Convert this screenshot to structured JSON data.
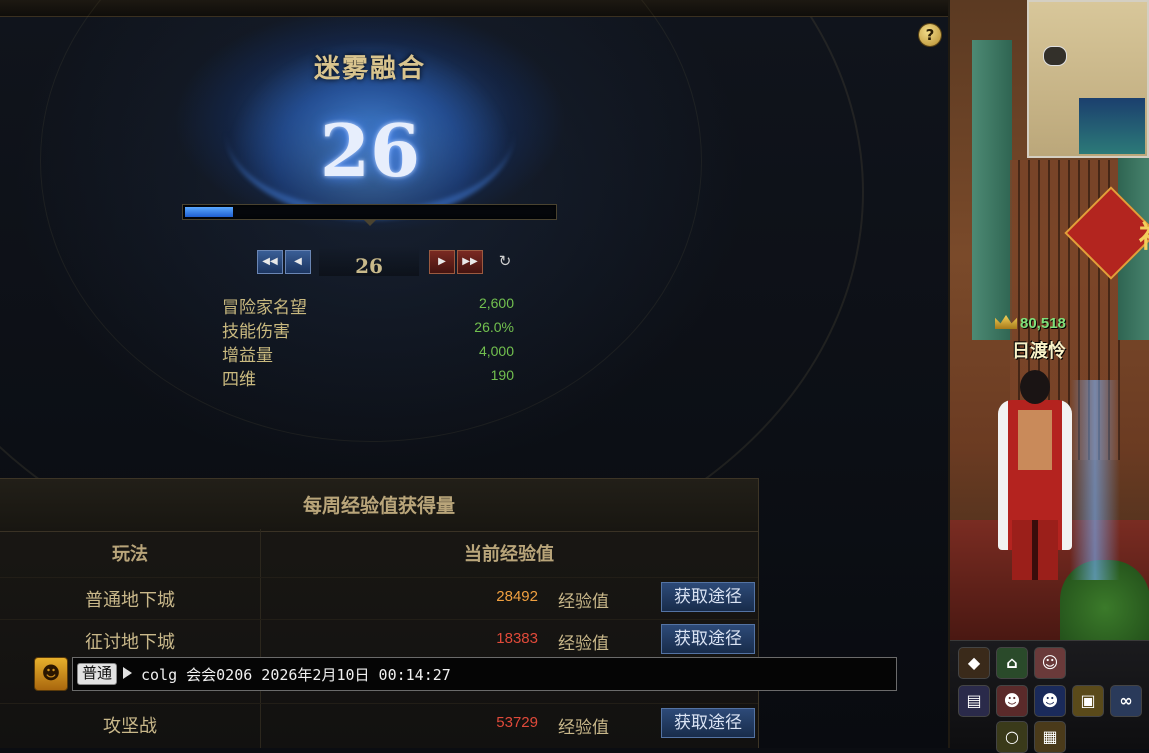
{
  "panel": {
    "title": "迷雾融合",
    "level": "26",
    "progress_fraction": 0.13,
    "help_label": "?",
    "nav": {
      "first_label": "◀◀",
      "prev_label": "◀",
      "current": "26",
      "next_label": "▶",
      "last_label": "▶▶",
      "refresh_label": "↻"
    },
    "stats": [
      {
        "label": "冒险家名望",
        "value": "2,600"
      },
      {
        "label": "技能伤害",
        "value": "26.0%"
      },
      {
        "label": "增益量",
        "value": "4,000"
      },
      {
        "label": "四维",
        "value": "190"
      }
    ]
  },
  "weekly": {
    "title": "每周经验值获得量",
    "col_mode": "玩法",
    "col_exp": "当前经验值",
    "rows": [
      {
        "name": "普通地下城",
        "value": "28492",
        "unit": "经验值",
        "button": "获取途径",
        "color": "#f0a040"
      },
      {
        "name": "征讨地下城",
        "value": "18383",
        "unit": "经验值",
        "button": "获取途径",
        "color": "#e04a3a"
      },
      {
        "name": "攻坚战",
        "value": "53729",
        "unit": "经验值",
        "button": "获取途径",
        "color": "#e04a3a"
      }
    ]
  },
  "chat": {
    "channel": "普通",
    "message": "colg 会会0206 2026年2月10日 00:14:27"
  },
  "scene": {
    "fame": "80,518",
    "character_name": "日渡怜",
    "fu_glyph": "福"
  },
  "colors": {
    "accent_gold": "#d9c48e",
    "stat_green": "#72c04f",
    "button_blue": "#2d4a78",
    "progress_blue": "#3b82f0"
  }
}
